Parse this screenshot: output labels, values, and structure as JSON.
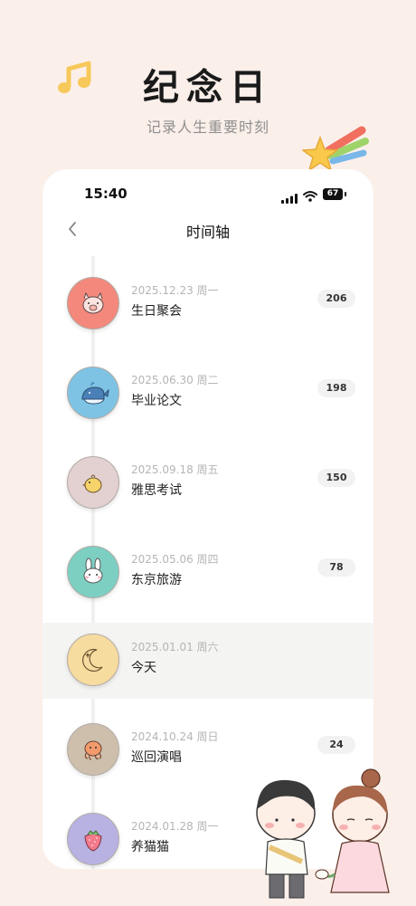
{
  "header": {
    "title": "纪念日",
    "subtitle": "记录人生重要时刻"
  },
  "status_bar": {
    "time": "15:40",
    "battery": "67"
  },
  "nav": {
    "title": "时间轴"
  },
  "events": [
    {
      "date": "2025.12.23 周一",
      "name": "生日聚会",
      "days": "206",
      "icon": "pig-icon",
      "color": "#f4887c"
    },
    {
      "date": "2025.06.30 周二",
      "name": "毕业论文",
      "days": "198",
      "icon": "whale-icon",
      "color": "#7ec3e3"
    },
    {
      "date": "2025.09.18 周五",
      "name": "雅思考试",
      "days": "150",
      "icon": "chick-icon",
      "color": "#e3d0d0"
    },
    {
      "date": "2025.05.06 周四",
      "name": "东京旅游",
      "days": "78",
      "icon": "bunny-icon",
      "color": "#7dcfc2"
    },
    {
      "date": "2025.01.01 周六",
      "name": "今天",
      "days": "",
      "icon": "moon-icon",
      "color": "#f7dca0"
    },
    {
      "date": "2024.10.24 周日",
      "name": "巡回演唱",
      "days": "24",
      "icon": "octopus-icon",
      "color": "#cdbfac"
    },
    {
      "date": "2024.01.28 周一",
      "name": "养猫猫",
      "days": "",
      "icon": "strawberry-icon",
      "color": "#b8b2e3"
    }
  ]
}
